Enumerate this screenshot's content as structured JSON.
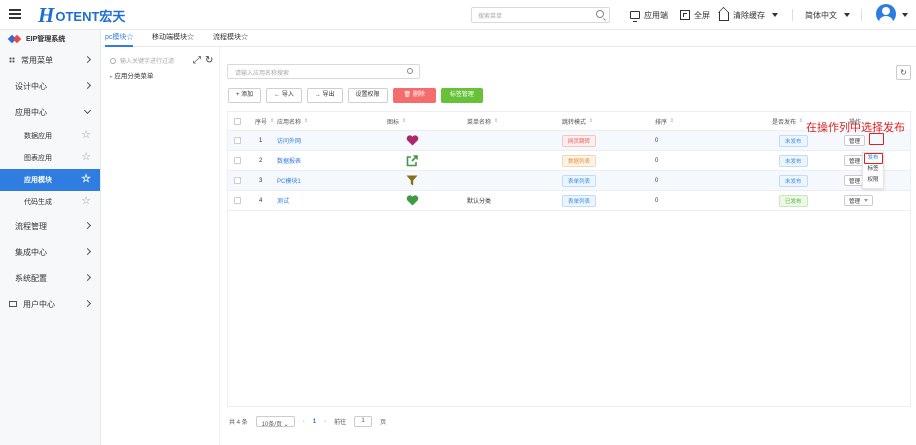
{
  "header": {
    "logo_h": "H",
    "logo_text": "OTENT宏天",
    "search_placeholder": "搜索菜单",
    "nav_app": "应用端",
    "nav_fullscreen": "全屏",
    "nav_clear_cache": "清除缓存",
    "nav_language": "简体中文"
  },
  "sidebar": {
    "title": "EIP管理系统",
    "items": [
      {
        "label": "常用菜单"
      },
      {
        "label": "设计中心"
      },
      {
        "label": "应用中心"
      },
      {
        "label": "数据应用"
      },
      {
        "label": "图表应用"
      },
      {
        "label": "应用模块"
      },
      {
        "label": "代码生成"
      },
      {
        "label": "流程管理"
      },
      {
        "label": "集成中心"
      },
      {
        "label": "系统配置"
      },
      {
        "label": "用户中心"
      }
    ]
  },
  "tabs": [
    {
      "label": "pc模块☆"
    },
    {
      "label": "移动端模块☆"
    },
    {
      "label": "流程模块☆"
    }
  ],
  "tree": {
    "search_placeholder": "输入关键字进行过滤",
    "node": "应用分类菜单"
  },
  "main": {
    "search_placeholder": "请输入应用名称搜索",
    "buttons": {
      "add": "+ 添加",
      "import": "← 导入",
      "export": "→ 导出",
      "permissions": "设置权限",
      "delete": "删除",
      "tags": "标签管理"
    },
    "columns": [
      "序号",
      "应用名称",
      "图标",
      "菜单名称",
      "跳转模式",
      "排序",
      "是否发布",
      "操作"
    ],
    "rows": [
      {
        "no": "1",
        "name": "访问外网",
        "menu": "",
        "mode": "网页跳转",
        "sort": "0",
        "published": "未发布",
        "action": "管理"
      },
      {
        "no": "2",
        "name": "数据报表",
        "menu": "",
        "mode": "数据列表",
        "sort": "0",
        "published": "未发布",
        "action": "管理"
      },
      {
        "no": "3",
        "name": "PC模块1",
        "menu": "",
        "mode": "表单列表",
        "sort": "0",
        "published": "未发布",
        "action": "管理"
      },
      {
        "no": "4",
        "name": "测试",
        "menu": "默认分类",
        "mode": "表单列表",
        "sort": "0",
        "published": "已发布",
        "action": "管理"
      }
    ],
    "dropdown": [
      "发布",
      "标签",
      "权限"
    ],
    "annotation": "在操作列中选择发布"
  },
  "pagination": {
    "total": "共 4 条",
    "page_size": "10条/页",
    "current_page": "1",
    "goto_label": "前往",
    "goto_value": "1",
    "page_unit": "页"
  },
  "colors": {
    "accent": "#2f7de1",
    "annotation": "#e02020",
    "delete": "#f56c6c",
    "tag_manage": "#67c23a",
    "heart": "#b0266e",
    "filter": "#8a6d1b",
    "green_heart": "#3f9a43"
  }
}
